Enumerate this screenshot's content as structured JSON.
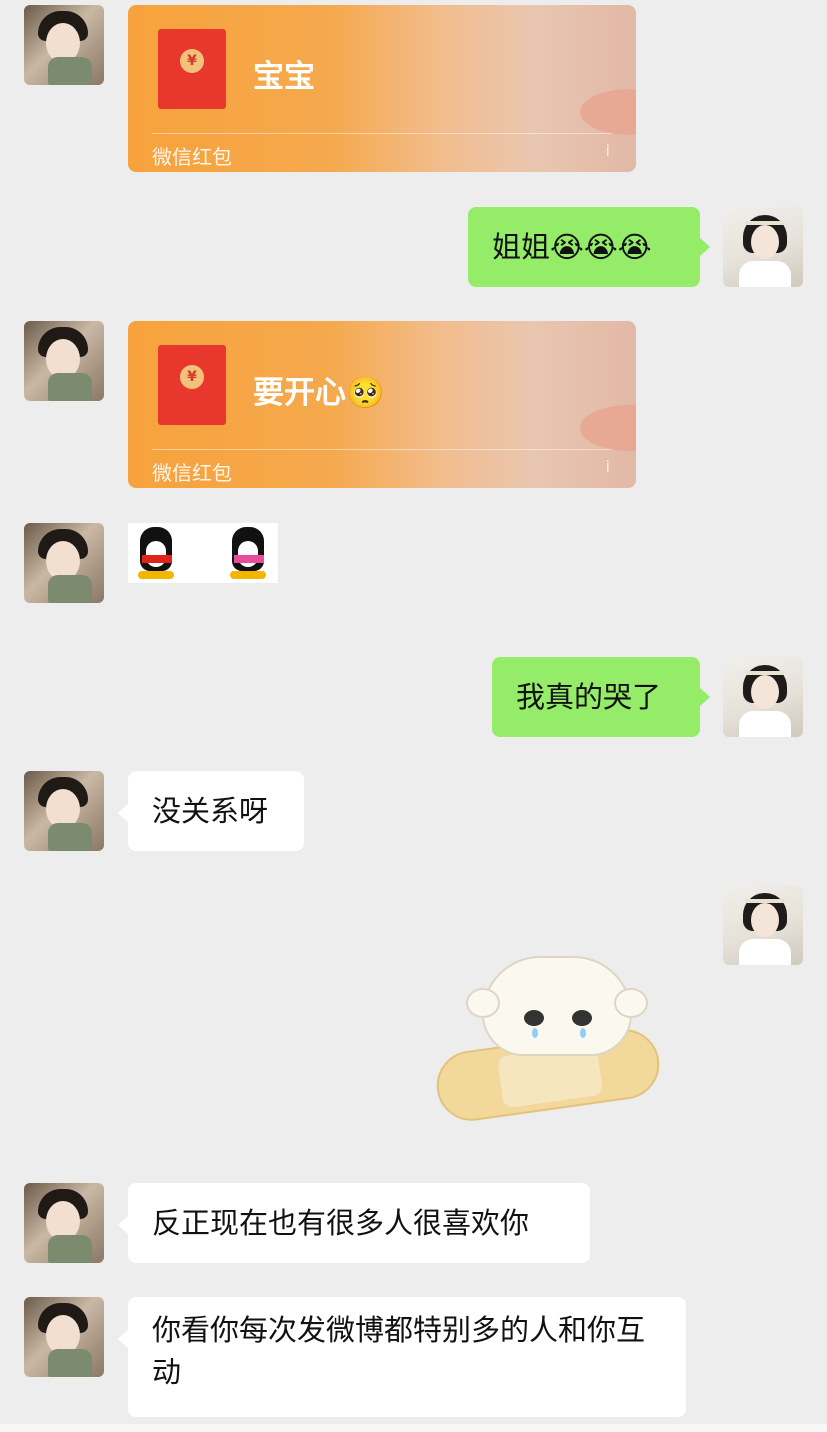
{
  "messages": {
    "m1": {
      "type": "red-packet",
      "title": "宝宝",
      "footer": "微信红包",
      "info": "i"
    },
    "m2": {
      "type": "text",
      "text": "姐姐😭😭😭"
    },
    "m3": {
      "type": "red-packet",
      "title": "要开心🥺",
      "footer": "微信红包",
      "info": "i"
    },
    "m4": {
      "type": "sticker",
      "sticker": "qq-penguins"
    },
    "m5": {
      "type": "text",
      "text": "我真的哭了"
    },
    "m6": {
      "type": "text",
      "text": "没关系呀"
    },
    "m7": {
      "type": "sticker",
      "sticker": "crying-bandage-creature"
    },
    "m8": {
      "type": "text",
      "text": "反正现在也有很多人很喜欢你"
    },
    "m9": {
      "type": "text",
      "text": "你看你每次发微博都特别多的人和你互动"
    }
  },
  "colors": {
    "background": "#ededed",
    "incoming_bubble": "#ffffff",
    "outgoing_bubble": "#95ec69",
    "red_packet": "#f7a23c"
  }
}
